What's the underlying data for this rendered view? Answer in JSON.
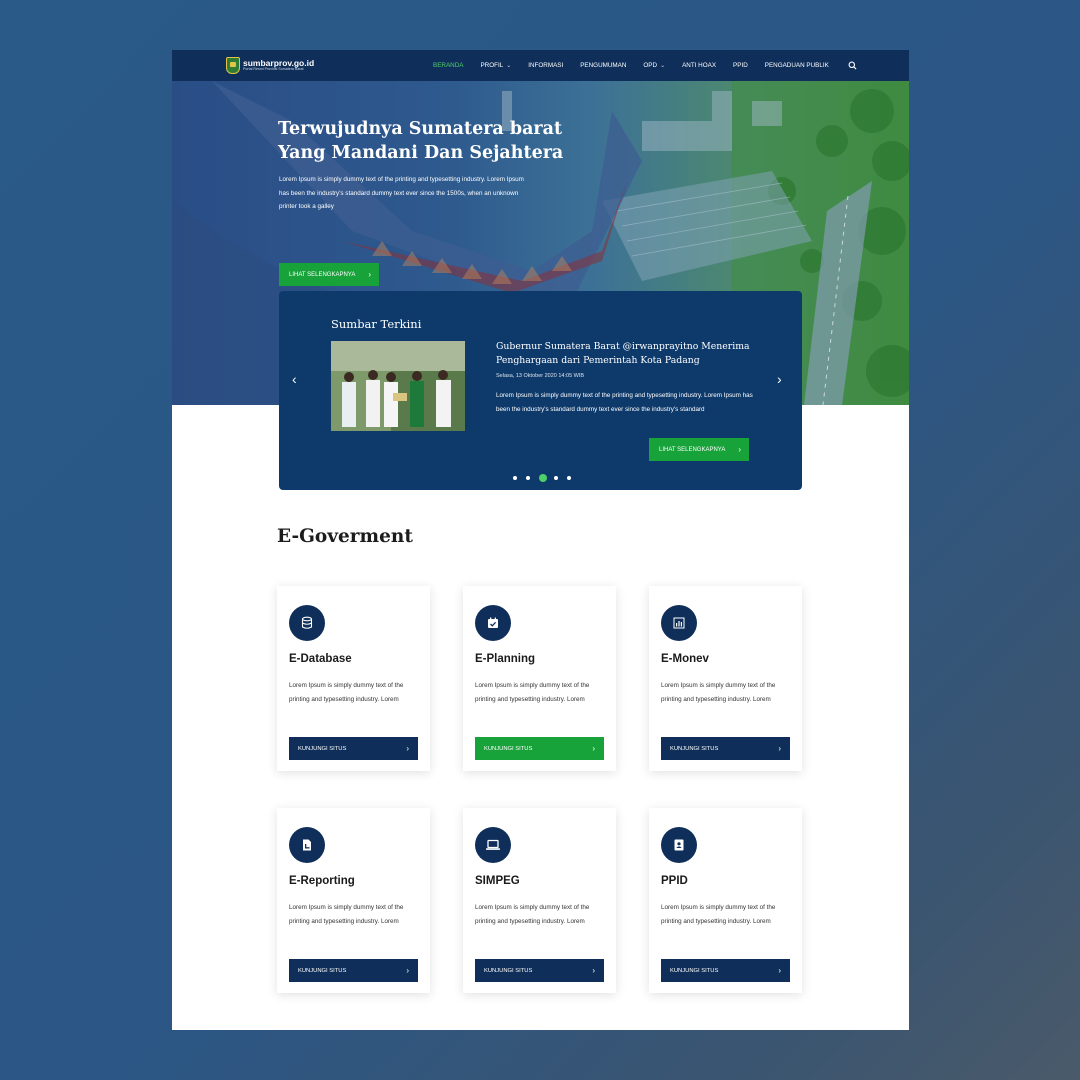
{
  "nav": {
    "logo_title": "sumbarprov.go.id",
    "logo_subtitle": "Portal Resmi Provinsi Sumatera Barat",
    "items": [
      {
        "label": "BERANDA",
        "active": true,
        "dropdown": false
      },
      {
        "label": "PROFIL",
        "active": false,
        "dropdown": true
      },
      {
        "label": "INFORMASI",
        "active": false,
        "dropdown": false
      },
      {
        "label": "PENGUMUMAN",
        "active": false,
        "dropdown": false
      },
      {
        "label": "OPD",
        "active": false,
        "dropdown": true
      },
      {
        "label": "ANTI HOAX",
        "active": false,
        "dropdown": false
      },
      {
        "label": "PPID",
        "active": false,
        "dropdown": false
      },
      {
        "label": "PENGADUAN PUBLIK",
        "active": false,
        "dropdown": false
      }
    ],
    "search_icon": "search-icon"
  },
  "hero": {
    "title_line1": "Terwujudnya Sumatera barat",
    "title_line2": "Yang Mandani Dan Sejahtera",
    "description": "Lorem Ipsum is simply dummy text of the printing and typesetting industry. Lorem Ipsum has been the industry's standard dummy text ever since the 1500s, when an unknown printer took a galley",
    "button_label": "LIHAT SELENGKAPNYA"
  },
  "news": {
    "heading": "Sumbar Terkini",
    "title": "Gubernur Sumatera Barat @irwanprayitno Menerima Penghargaan dari Pemerintah Kota Padang",
    "date": "Selasa, 13 Oktober 2020 14:05 WIB",
    "description": "Lorem Ipsum is simply dummy text of the printing and typesetting industry. Lorem Ipsum has been the industry's standard dummy text ever since  the industry's standard",
    "button_label": "LIHAT SELENGKAPNYA",
    "slides_total": 5,
    "active_slide": 3
  },
  "egov": {
    "heading": "E-Goverment",
    "cards": [
      {
        "title": "E-Database",
        "desc": "Lorem Ipsum is simply dummy text of the printing and typesetting industry. Lorem",
        "button": "KUNJUNGI SITUS",
        "icon": "database-icon",
        "highlight": false
      },
      {
        "title": "E-Planning",
        "desc": "Lorem Ipsum is simply dummy text of the printing and typesetting industry. Lorem",
        "button": "KUNJUNGI SITUS",
        "icon": "calendar-check-icon",
        "highlight": true
      },
      {
        "title": "E-Monev",
        "desc": "Lorem Ipsum is simply dummy text of the printing and typesetting industry. Lorem",
        "button": "KUNJUNGI SITUS",
        "icon": "bar-chart-icon",
        "highlight": false
      },
      {
        "title": "E-Reporting",
        "desc": "Lorem Ipsum is simply dummy text of the printing and typesetting industry. Lorem",
        "button": "KUNJUNGI SITUS",
        "icon": "report-document-icon",
        "highlight": false
      },
      {
        "title": "SIMPEG",
        "desc": "Lorem Ipsum is simply dummy text of the printing and typesetting industry. Lorem",
        "button": "KUNJUNGI SITUS",
        "icon": "laptop-icon",
        "highlight": false
      },
      {
        "title": "PPID",
        "desc": "Lorem Ipsum is simply dummy text of the printing and typesetting industry. Lorem",
        "button": "KUNJUNGI SITUS",
        "icon": "contact-card-icon",
        "highlight": false
      }
    ]
  },
  "colors": {
    "nav_bg": "#0f2f5a",
    "accent_green": "#18a23a",
    "active_nav": "#4fcf6a",
    "news_bg": "#0e3a6b"
  }
}
